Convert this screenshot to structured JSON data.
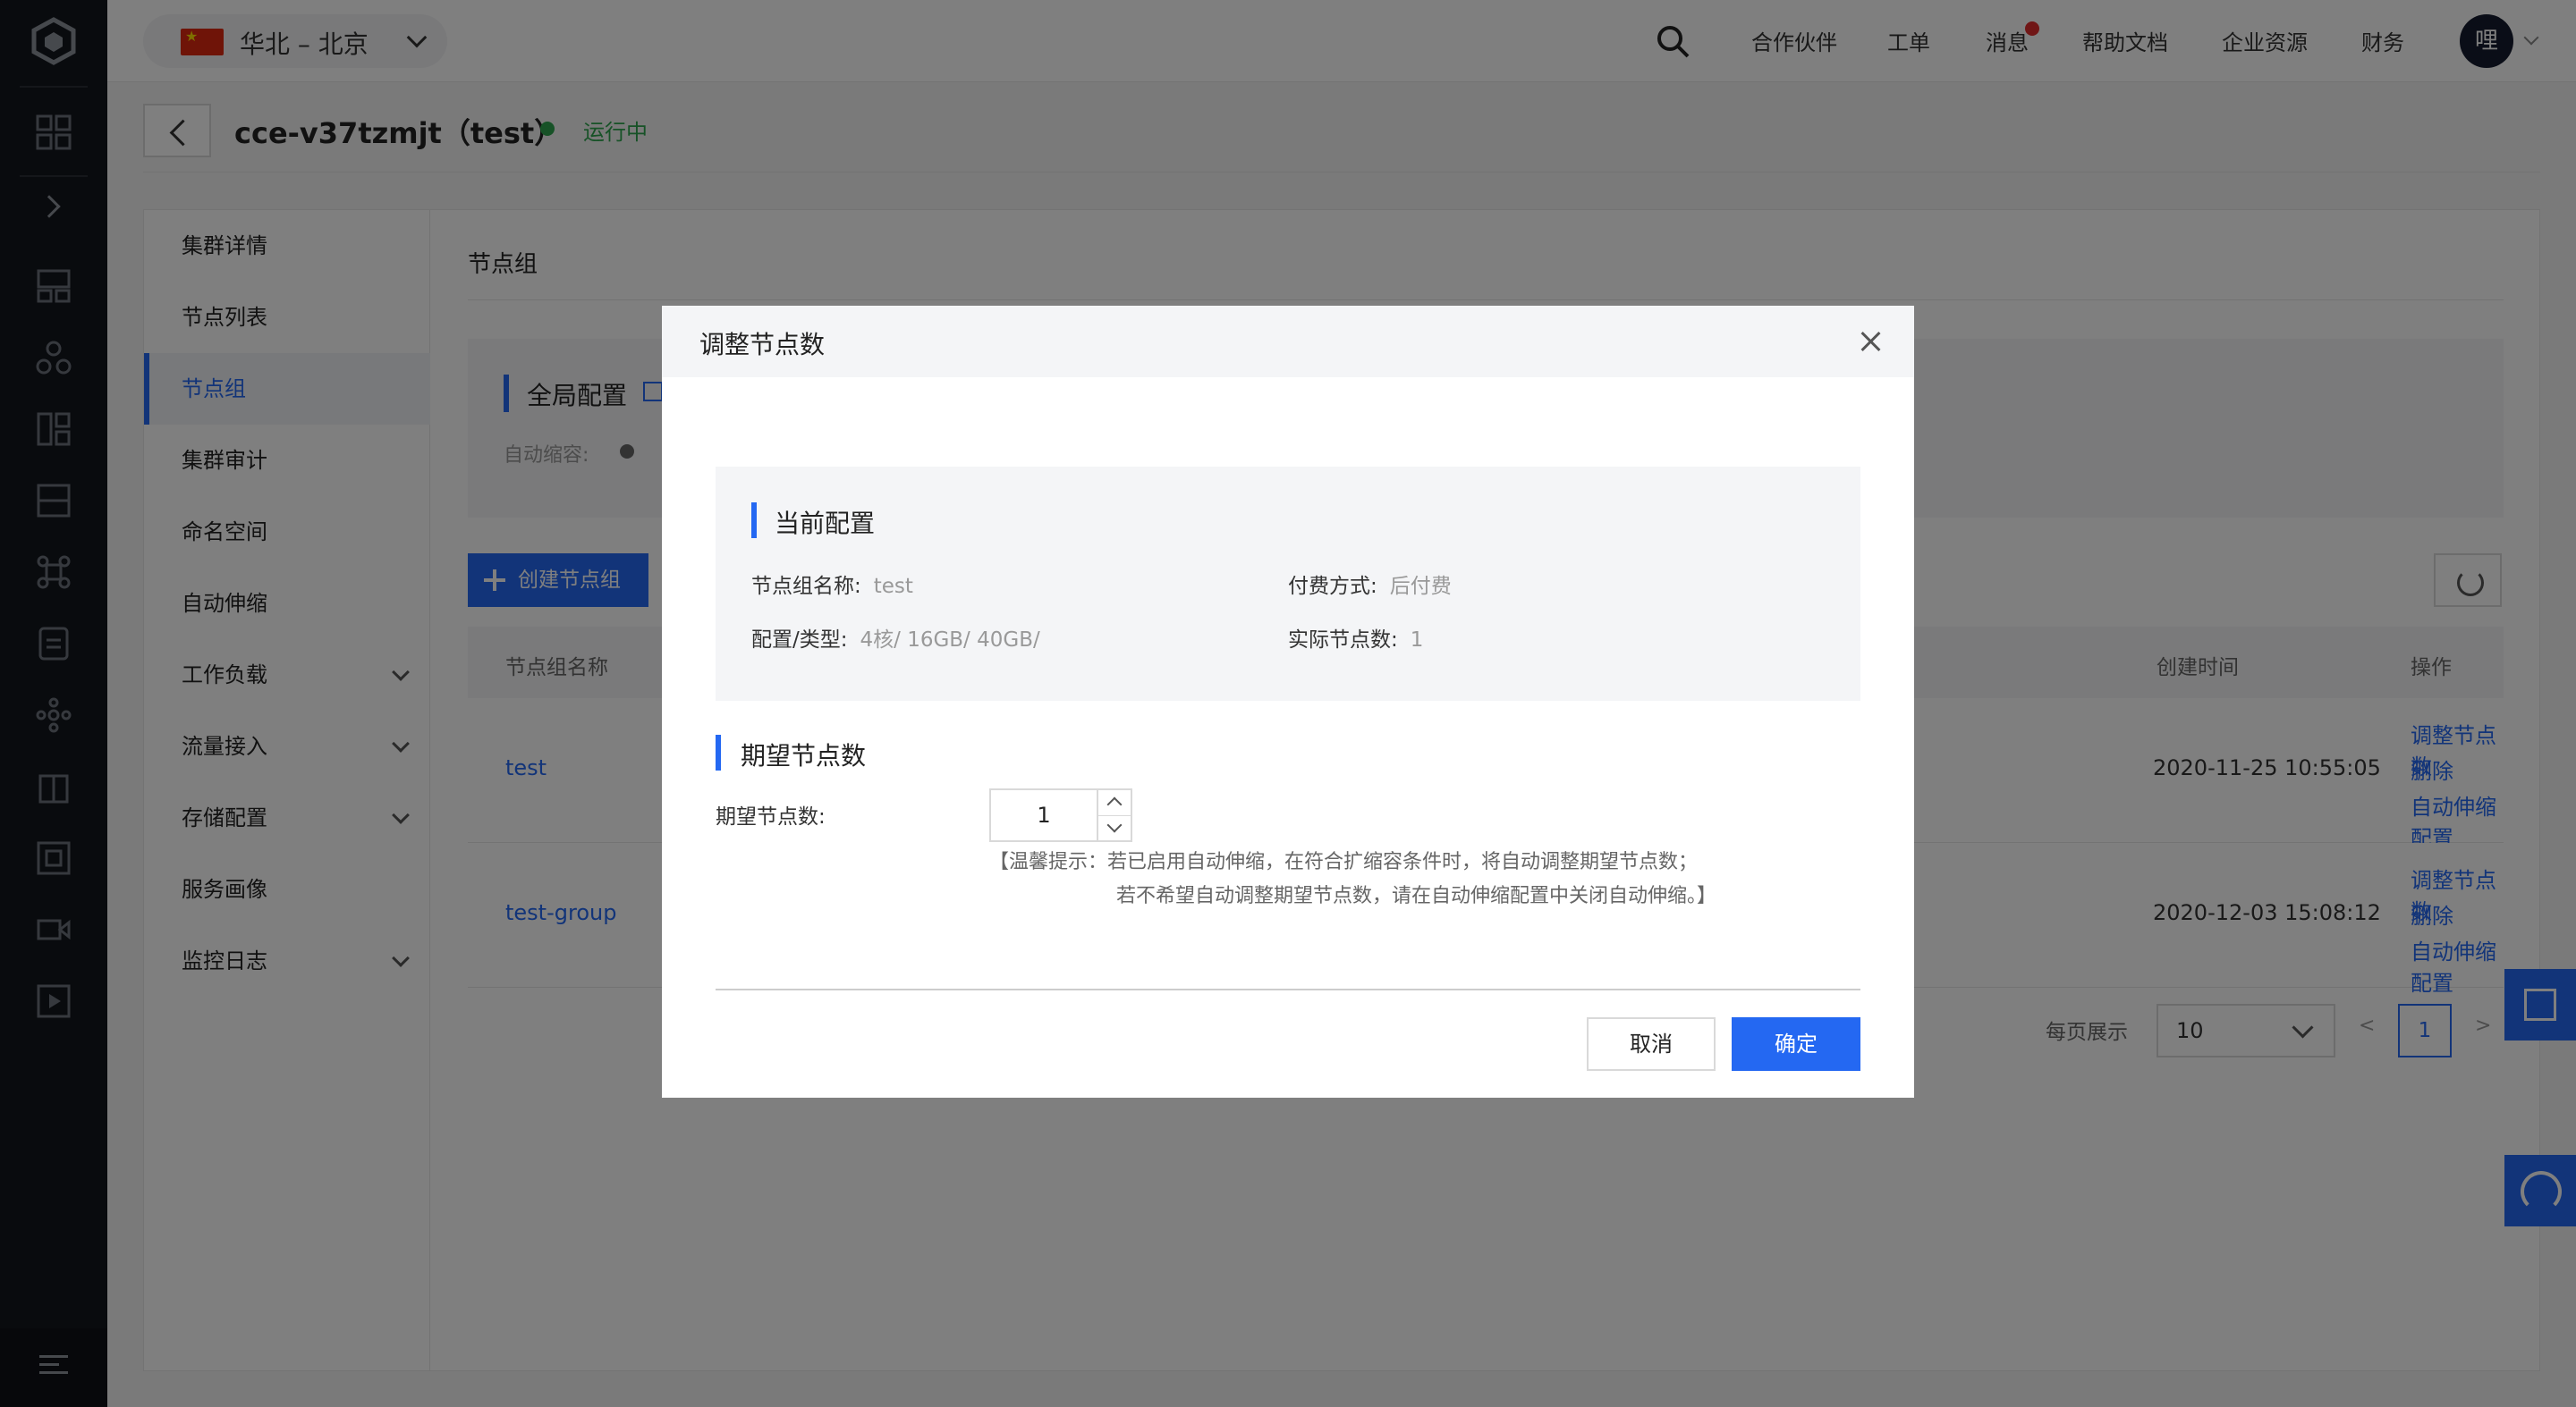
{
  "topbar": {
    "region": "华北 – 北京",
    "nav": [
      "合作伙伴",
      "工单",
      "消息",
      "帮助文档",
      "企业资源",
      "财务"
    ],
    "avatar": "哩"
  },
  "cluster": {
    "title": "cce-v37tzmjt（test）",
    "status": "运行中"
  },
  "subnav": {
    "items": [
      {
        "label": "集群详情"
      },
      {
        "label": "节点列表"
      },
      {
        "label": "节点组"
      },
      {
        "label": "集群审计"
      },
      {
        "label": "命名空间"
      },
      {
        "label": "自动伸缩"
      },
      {
        "label": "工作负载"
      },
      {
        "label": "流量接入"
      },
      {
        "label": "存储配置"
      },
      {
        "label": "服务画像"
      },
      {
        "label": "监控日志"
      }
    ]
  },
  "content": {
    "title": "节点组",
    "global_title": "全局配置",
    "global_label": "自动缩容:",
    "create_button": "创建节点组",
    "columns": [
      "节点组名称",
      "创建时间",
      "操作"
    ],
    "rows": [
      {
        "name": "test",
        "created": "2020-11-25 10:55:05",
        "ops": [
          "调整节点数",
          "删除",
          "自动伸缩配置"
        ]
      },
      {
        "name": "test-group",
        "created": "2020-12-03 15:08:12",
        "ops": [
          "调整节点数",
          "删除",
          "自动伸缩配置"
        ]
      }
    ],
    "pager": {
      "label": "每页展示",
      "page_size": "10",
      "prev": "<",
      "page": "1",
      "next": ">"
    }
  },
  "modal": {
    "title": "调整节点数",
    "current": {
      "title": "当前配置",
      "group_name_label": "节点组名称:",
      "group_name": "test",
      "billing_label": "付费方式:",
      "billing": "后付费",
      "spec_label": "配置/类型:",
      "spec": "4核/ 16GB/ 40GB/",
      "actual_label": "实际节点数:",
      "actual": "1"
    },
    "expected": {
      "title": "期望节点数",
      "label": "期望节点数:",
      "value": "1",
      "hint_line1": "【温馨提示：若已启用自动伸缩，在符合扩缩容条件时，将自动调整期望节点数；",
      "hint_line2": "若不希望自动调整期望节点数，请在自动伸缩配置中关闭自动伸缩。】"
    },
    "cancel": "取消",
    "confirm": "确定"
  }
}
